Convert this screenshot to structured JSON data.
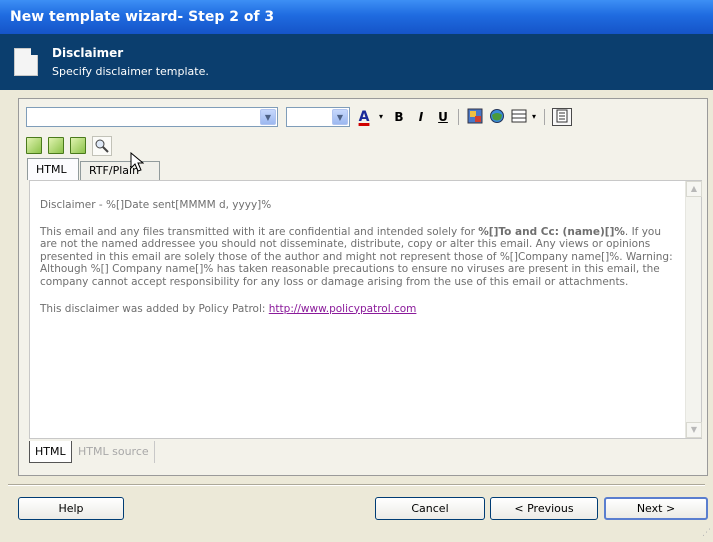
{
  "window": {
    "title": "New template wizard- Step 2 of 3"
  },
  "header": {
    "title": "Disclaimer",
    "subtitle": "Specify disclaimer template."
  },
  "toolbar": {
    "font_name": "",
    "font_size": "",
    "buttons": [
      "font-color",
      "bold",
      "italic",
      "underline",
      "insert-image",
      "insert-web",
      "insert-table",
      "page-properties"
    ],
    "labels": {
      "font_color": "A",
      "bold": "B",
      "italic": "I",
      "underline": "U"
    }
  },
  "toolbar2": {
    "buttons": [
      "new-template",
      "open-template",
      "save-template",
      "find"
    ]
  },
  "tabs": [
    {
      "label": "HTML"
    },
    {
      "label": "RTF/Plain"
    }
  ],
  "document": {
    "line1": "Disclaimer - %[]Date sent[MMMM d, yyyy]%",
    "para2_a": "This email and any files transmitted with it are confidential and intended solely for ",
    "para2_bold": "%[]To and Cc: (name)[]%",
    "para2_b": ". If you are not the named addressee you should not disseminate, distribute, copy or alter this email. Any views or opinions presented in this email are solely those of the author and might not represent those of %[]Company name[]%. Warning: Although %[] Company name[]% has taken reasonable precautions to ensure no viruses are present in this email, the company cannot accept responsibility for any loss or damage arising from the use of this email or attachments.",
    "para3_text": "This disclaimer was added by Policy Patrol: ",
    "para3_link": "http://www.policypatrol.com"
  },
  "view_tabs": [
    {
      "label": "HTML"
    },
    {
      "label": "HTML source"
    }
  ],
  "buttons": {
    "help": "Help",
    "cancel": "Cancel",
    "previous": "< Previous",
    "next": "Next >"
  },
  "colors": {
    "titlebar": "#1f6be0",
    "header": "#0b3e6e",
    "link": "#8a1a9a"
  }
}
